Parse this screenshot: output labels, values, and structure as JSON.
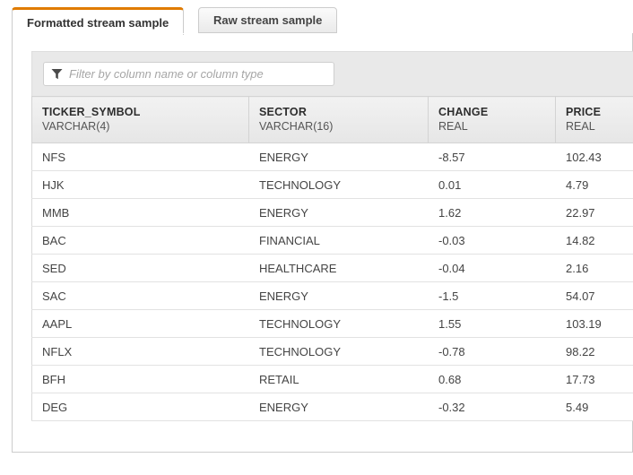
{
  "tabs": [
    {
      "id": "formatted",
      "label": "Formatted stream sample",
      "active": true
    },
    {
      "id": "raw",
      "label": "Raw stream sample",
      "active": false
    }
  ],
  "accent_color": "#e07b00",
  "filter": {
    "icon": "filter-funnel-icon",
    "value": "",
    "placeholder": "Filter by column name or column type"
  },
  "table": {
    "columns": [
      {
        "name": "TICKER_SYMBOL",
        "type": "VARCHAR(4)"
      },
      {
        "name": "SECTOR",
        "type": "VARCHAR(16)"
      },
      {
        "name": "CHANGE",
        "type": "REAL"
      },
      {
        "name": "PRICE",
        "type": "REAL"
      }
    ],
    "rows": [
      {
        "ticker": "NFS",
        "sector": "ENERGY",
        "change": "-8.57",
        "price": "102.43"
      },
      {
        "ticker": "HJK",
        "sector": "TECHNOLOGY",
        "change": "0.01",
        "price": "4.79"
      },
      {
        "ticker": "MMB",
        "sector": "ENERGY",
        "change": "1.62",
        "price": "22.97"
      },
      {
        "ticker": "BAC",
        "sector": "FINANCIAL",
        "change": "-0.03",
        "price": "14.82"
      },
      {
        "ticker": "SED",
        "sector": "HEALTHCARE",
        "change": "-0.04",
        "price": "2.16"
      },
      {
        "ticker": "SAC",
        "sector": "ENERGY",
        "change": "-1.5",
        "price": "54.07"
      },
      {
        "ticker": "AAPL",
        "sector": "TECHNOLOGY",
        "change": "1.55",
        "price": "103.19"
      },
      {
        "ticker": "NFLX",
        "sector": "TECHNOLOGY",
        "change": "-0.78",
        "price": "98.22"
      },
      {
        "ticker": "BFH",
        "sector": "RETAIL",
        "change": "0.68",
        "price": "17.73"
      },
      {
        "ticker": "DEG",
        "sector": "ENERGY",
        "change": "-0.32",
        "price": "5.49"
      }
    ]
  }
}
